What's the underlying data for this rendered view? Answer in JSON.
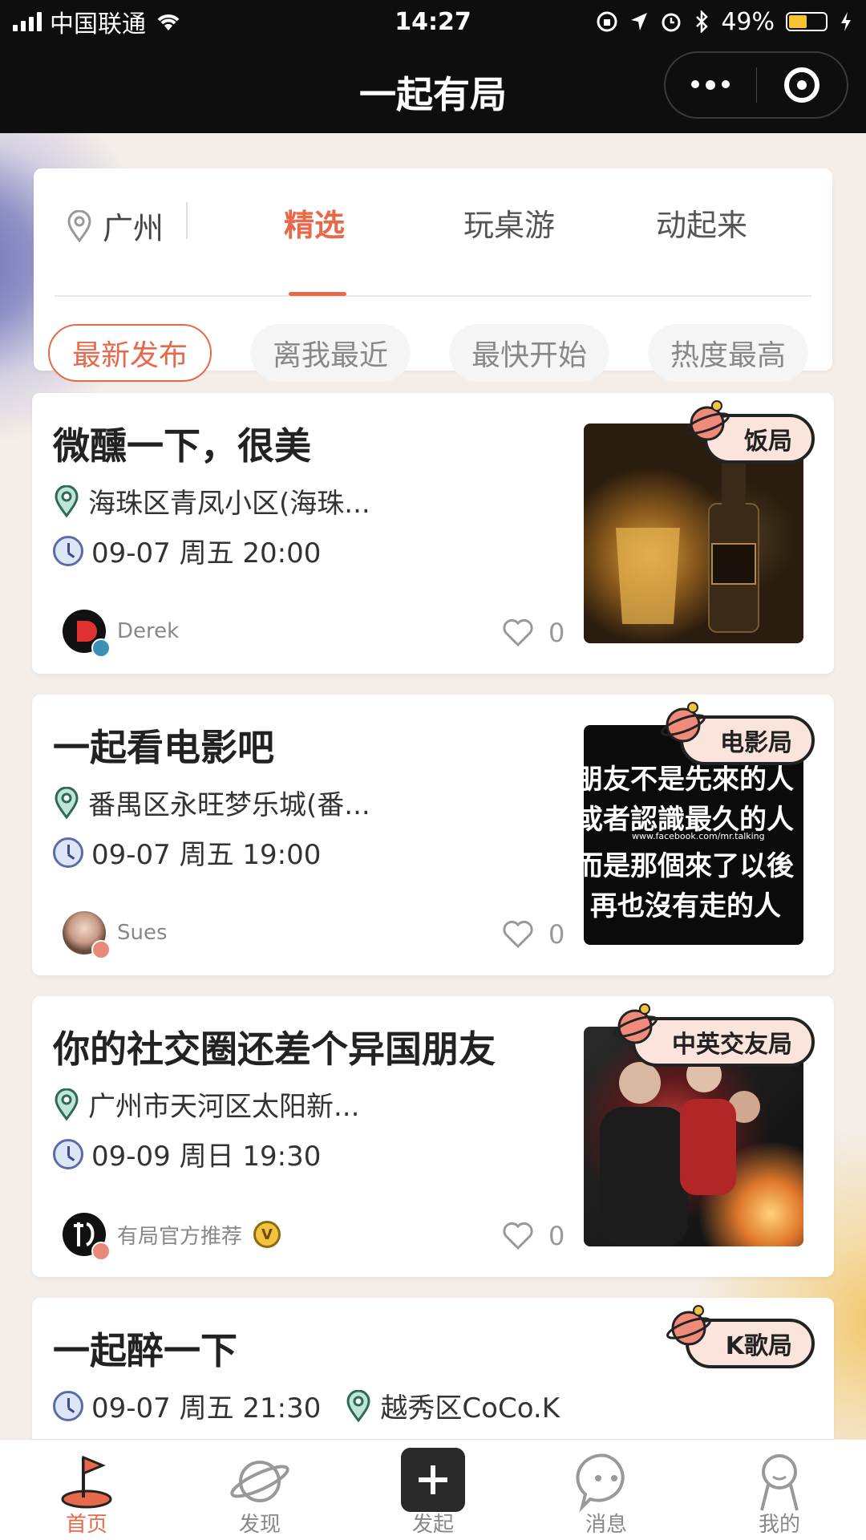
{
  "status_bar": {
    "carrier": "中国联通",
    "time": "14:27",
    "battery": "49%",
    "battery_level": 0.49
  },
  "nav": {
    "title": "一起有局"
  },
  "location": {
    "city": "广州"
  },
  "tabs": [
    {
      "label": "精选",
      "active": true
    },
    {
      "label": "玩桌游",
      "active": false
    },
    {
      "label": "动起来",
      "active": false
    }
  ],
  "filters": [
    {
      "label": "最新发布",
      "active": true
    },
    {
      "label": "离我最近",
      "active": false
    },
    {
      "label": "最快开始",
      "active": false
    },
    {
      "label": "热度最高",
      "active": false
    }
  ],
  "events": [
    {
      "title": "微醺一下，很美",
      "location": "海珠区青凤小区(海珠...",
      "time": "09-07 周五 20:00",
      "user": "Derek",
      "likes": "0",
      "tag": "饭局"
    },
    {
      "title": "一起看电影吧",
      "location": "番禺区永旺梦乐城(番...",
      "time": "09-07 周五 19:00",
      "user": "Sues",
      "likes": "0",
      "tag": "电影局",
      "image_text": [
        "朋友不是先來的人",
        "或者認識最久的人",
        "www.facebook.com/mr.talking",
        "而是那個來了以後",
        "再也沒有走的人"
      ]
    },
    {
      "title": "你的社交圈还差个异国朋友",
      "location": "广州市天河区太阳新...",
      "time": "09-09 周日 19:30",
      "user": "有局官方推荐",
      "likes": "0",
      "tag": "中英交友局",
      "badge": "V"
    },
    {
      "title": "一起醉一下",
      "location": "越秀区CoCo.K",
      "time": "09-07 周五 21:30",
      "tag": "K歌局"
    }
  ],
  "tabbar": [
    {
      "label": "首页",
      "icon": "home-flag-icon",
      "active": true
    },
    {
      "label": "发现",
      "icon": "planet-icon",
      "active": false
    },
    {
      "label": "发起",
      "icon": "plus-icon",
      "active": false
    },
    {
      "label": "消息",
      "icon": "message-bubble-icon",
      "active": false
    },
    {
      "label": "我的",
      "icon": "profile-icon",
      "active": false
    }
  ],
  "colors": {
    "accent": "#e8684a",
    "dark": "#0e0e0e",
    "tag_bg": "#fbe4dc"
  }
}
